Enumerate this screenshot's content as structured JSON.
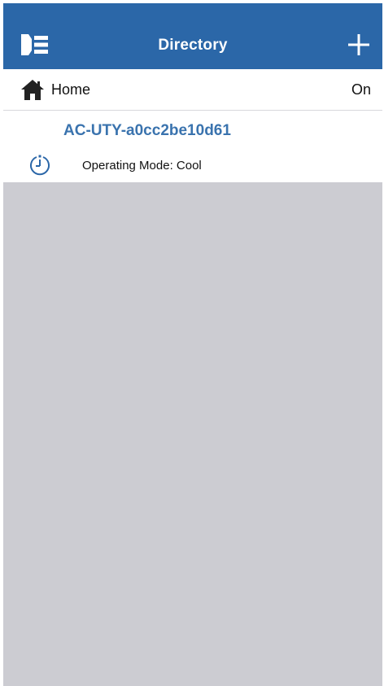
{
  "header": {
    "title": "Directory",
    "menu_icon": "sidebar-menu-icon",
    "add_icon": "plus-icon"
  },
  "location": {
    "icon": "home-icon",
    "name": "Home",
    "status": "On"
  },
  "device": {
    "name": "AC-UTY-a0cc2be10d61",
    "status_icon": "timer-icon",
    "mode_text": "Operating Mode: Cool"
  },
  "colors": {
    "header_bg": "#2b67a8",
    "device_name": "#3a73ae",
    "empty_bg": "#ccccd2"
  }
}
